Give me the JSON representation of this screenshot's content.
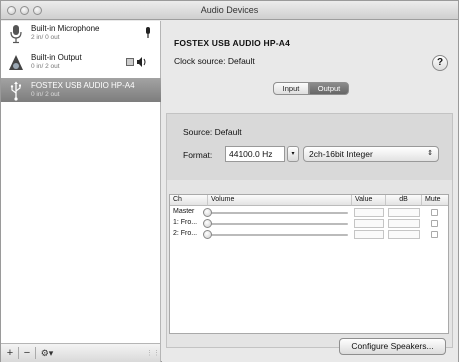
{
  "window": {
    "title": "Audio Devices"
  },
  "sidebar": {
    "devices": [
      {
        "name": "Built-in Microphone",
        "io": "2 in/ 0 out",
        "icon": "microphone-icon",
        "badge": "microphone-badge-icon"
      },
      {
        "name": "Built-in Output",
        "io": "0 in/ 2 out",
        "icon": "speaker-icon",
        "badge": "speaker-badge-icon"
      },
      {
        "name": "FOSTEX USB AUDIO HP-A4",
        "io": "0 in/ 2 out",
        "icon": "usb-icon",
        "selected": true
      }
    ],
    "toolbar": {
      "add": "+",
      "remove": "−",
      "gear": "⚙▾"
    }
  },
  "main": {
    "device_title": "FOSTEX USB AUDIO HP-A4",
    "clock_source": "Clock source: Default",
    "help": "?",
    "tabs": [
      {
        "label": "Input",
        "active": false
      },
      {
        "label": "Output",
        "active": true
      }
    ],
    "source": "Source:  Default",
    "format_label": "Format:",
    "format_rate": "44100.0 Hz",
    "format_type": "2ch-16bit Integer",
    "table": {
      "headers": [
        "Ch",
        "Volume",
        "Value",
        "dB",
        "Mute"
      ],
      "rows": [
        {
          "ch": "Master"
        },
        {
          "ch": "1: Fro..."
        },
        {
          "ch": "2: Fro..."
        }
      ]
    },
    "configure_button": "Configure Speakers..."
  }
}
